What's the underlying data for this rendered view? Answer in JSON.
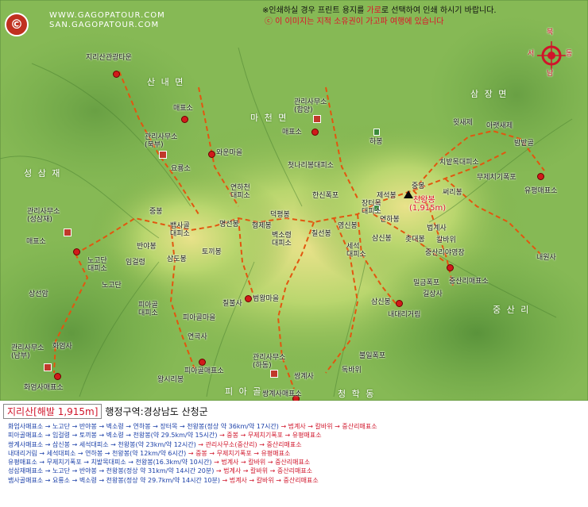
{
  "notice": {
    "line1_a": "※인쇄하실 경우 프린트 용지를 ",
    "line1_b": "가로",
    "line1_c": "로 선택하여 인쇄 하시기 바랍니다.",
    "line2": "ⓒ 이 이미지는 지적 소유권이 가고파 여행에 있습니다"
  },
  "logo": {
    "symbol": "©",
    "site1": "WWW.GAGOPATOUR.COM",
    "site2": "SAN.GAGOPATOUR.COM"
  },
  "compass": {
    "north": "북",
    "south": "남",
    "east": "동",
    "west": "서",
    "color": "#d0142a"
  },
  "areas": {
    "sannae": "산 내 면",
    "macheon": "마 천 면",
    "samjang": "삼 장 면",
    "seongsamjae": "성 삼 재",
    "jungsanri": "중 산 리",
    "piagol": "피 아 골",
    "cheonghak": "청 학 동"
  },
  "places": {
    "jirisan_town": "지리산관광타운",
    "maepyoso_top": "매표소",
    "office_bukbu": "관리사무소\n(북부)",
    "yoryongso": "요룡소",
    "wahun": "와운마을",
    "office_hamyang": "관리사무소\n(함양)",
    "maepyoso_macheon": "매표소",
    "habong": "하봉",
    "chotnaribong": "첫나리봉대피소",
    "hansinpok": "한신폭포",
    "seongbuk": "제석봉",
    "cheonwang": "천왕봉",
    "cheonwang_height": "(1,915m)",
    "jungbong": "중봉",
    "jangteomok": "장터목\n대피소",
    "yeonhabong": "연하봉",
    "beopgyesa": "법계사",
    "kalbawi": "칼바위",
    "saesese": "윗새제",
    "araesese": "아랫새제",
    "bamtgol": "밤밭골",
    "chibatmok": "치밭목대피소",
    "mujechi": "무제치기폭포",
    "ssaribong": "써리봉",
    "yupyeong": "유평매표소",
    "seongsamjae_office": "관리사무소\n(성삼재)",
    "maepyoso_left": "매표소",
    "nogodan_shelter": "노고단\n대피소",
    "nogodan": "노고단",
    "sangsunak": "상선암",
    "banyabong": "반야봉",
    "jungbong2": "중봉",
    "baemsagol": "뱀사골\n대피소",
    "imgeoryeong": "임걸령",
    "samdobong": "삼도봉",
    "tokkibong": "토끼봉",
    "yeonhacheon": "연하천\n대피소",
    "myeongseonbong": "명선봉",
    "hyeongjebong": "형제봉",
    "deokpyeongbong": "덕평봉",
    "byeoksoryeong": "벽소령\n대피소",
    "chilseonbong": "칠선봉",
    "yeongsinbong": "영신봉",
    "seseok": "세석\n대피소",
    "samsinbong": "삼신봉",
    "hoemisbong": "촛대봉",
    "jungsanri_camp": "중산리야영장",
    "jungsanri_maepyo": "중산리매표소",
    "naewonsa": "내원사",
    "milgeunpok": "밀금폭포",
    "gilsangsa": "길상사",
    "samsinbong2": "삼신봉",
    "naedaeri": "내대리거림",
    "piagol_shelter": "피아골\n대피소",
    "piagol_village": "피아골마을",
    "chilbul": "칠불사",
    "beomwang": "범왕마을",
    "yeongoksa": "연곡사",
    "piagol_maepyo": "피아골매표소",
    "wangsirbong": "왕시리봉",
    "office_gurye": "관리사무소\n(남부)",
    "hwaeomsa": "화엄사",
    "hwaeomsa_maepyo": "화엄사매표소",
    "office_hadong": "관리사무소\n(하동)",
    "ssanggyesa": "쌍계사",
    "ssanggyesa_maepyo": "쌍계사매표소",
    "bulil": "불일폭포",
    "seongju": "청학동",
    "dokbaji": "독바위",
    "samsinbong3": "삼신봉"
  },
  "title": {
    "name": "지리산[해발 1,915m]",
    "admin": "행정구역:경상남도 산청군"
  },
  "routes": [
    {
      "text": "화엄사매표소 → 노고단 → 반야봉 → 벽소령 → 연하봉 → 장터목 → 천왕봉(정상 약 36km/약 17시간) ",
      "tail": "→ 법계사 → 칼바위 → 중산리매표소"
    },
    {
      "text": "피아골매표소 → 임걸령 → 토끼봉 → 벽소령 → 천왕봉(약 29.5km/약 15시간) ",
      "tail": "→ 중봉 → 무제치기폭포 → 유평매표소"
    },
    {
      "text": "쌍계사매표소 → 삼신봉 → 세석대피소 → 천왕봉(약 23km/약 12시간) ",
      "tail": "→ 관리사무소(중산리) → 중산리매표소"
    },
    {
      "text": "내대리거림 → 세석대피소 → 연하봉 → 천왕봉(약 12km/약 6시간) ",
      "tail": "→ 중봉 → 무제치기폭포 → 유평매표소"
    },
    {
      "text": "유평매표소 → 무제치기폭포 → 치밭목대피소 → 천왕봉(16.3km/약 10시간) ",
      "tail": "→ 법계사 → 칼바위 → 중산리매표소"
    },
    {
      "text": "성삼재매표소 → 노고단 → 반야봉 → 천왕봉(정상 약 31km/약 14시간 20분) ",
      "tail": "→ 법계사 → 칼바위 → 중산리매표소"
    },
    {
      "text": "뱀사골매표소 → 요룡소 → 벽소령 → 천왕봉(정상 약 29.7km/약 14시간 10분) ",
      "tail": "→ 법계사 → 칼바위 → 중산리매표소"
    }
  ]
}
